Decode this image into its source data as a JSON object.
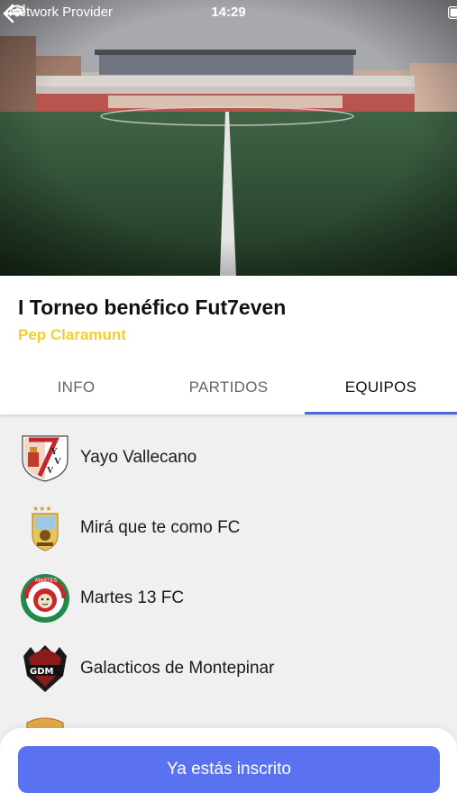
{
  "status_bar": {
    "carrier": "Network Provider",
    "time": "14:29"
  },
  "tournament": {
    "title": "I Torneo benéfico Fut7even",
    "organizer": "Pep Claramunt"
  },
  "tabs": [
    {
      "label": "INFO",
      "active": false
    },
    {
      "label": "PARTIDOS",
      "active": false
    },
    {
      "label": "EQUIPOS",
      "active": true
    }
  ],
  "teams": [
    {
      "name": "Yayo Vallecano",
      "logo": "yayo-vallecano-crest-icon"
    },
    {
      "name": "Mirá que te como FC",
      "logo": "mira-que-te-como-crest-icon"
    },
    {
      "name": "Martes 13 FC",
      "logo": "martes-13-lion-crest-icon"
    },
    {
      "name": "Galacticos de Montepinar",
      "logo": "gdm-crest-icon"
    },
    {
      "name": "",
      "logo": "partial-crest-icon"
    }
  ],
  "colors": {
    "accent": "#4b6bd8",
    "cta": "#5a72f0",
    "organizer": "#f2cf2b"
  },
  "cta": {
    "label": "Ya estás inscrito"
  }
}
